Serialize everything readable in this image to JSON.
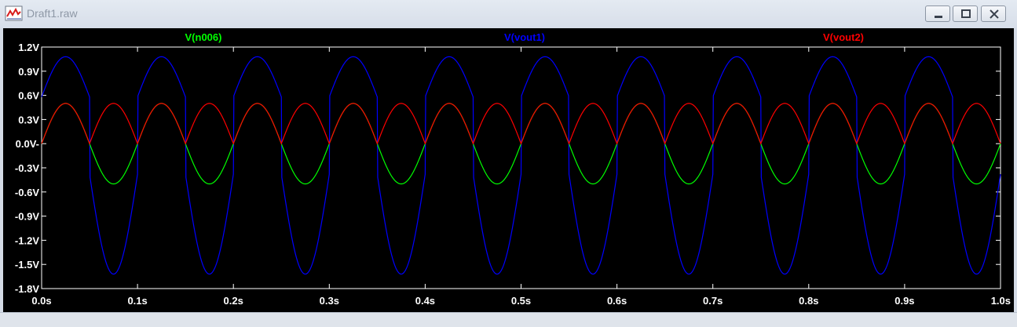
{
  "window": {
    "title": "Draft1.raw",
    "icon": "waveform-plot-icon",
    "controls": {
      "minimize": "minimize-icon",
      "maximize": "maximize-icon",
      "close": "close-icon"
    }
  },
  "colors": {
    "background": "#000000",
    "frame": "#ffffff",
    "axis_text": "#ffffff",
    "n006": "#00ff00",
    "vout1": "#0000ff",
    "vout2": "#ff0000"
  },
  "chart_data": {
    "type": "line",
    "title": "",
    "xlabel": "",
    "ylabel": "",
    "xlim": [
      0,
      1.0
    ],
    "ylim": [
      -1.8,
      1.2
    ],
    "grid": false,
    "legend_position": "top",
    "x_ticks": [
      0,
      0.1,
      0.2,
      0.3,
      0.4,
      0.5,
      0.6,
      0.7,
      0.8,
      0.9,
      1.0
    ],
    "x_tick_labels": [
      "0.0s",
      "0.1s",
      "0.2s",
      "0.3s",
      "0.4s",
      "0.5s",
      "0.6s",
      "0.7s",
      "0.8s",
      "0.9s",
      "1.0s"
    ],
    "y_ticks": [
      1.2,
      0.9,
      0.6,
      0.3,
      0.0,
      -0.3,
      -0.6,
      -0.9,
      -1.2,
      -1.5,
      -1.8
    ],
    "y_tick_labels": [
      "1.2V",
      "0.9V",
      "0.6V",
      "0.3V",
      "0.0V-",
      "-0.3V",
      "-0.6V",
      "-0.9V",
      "-1.2V",
      "-1.5V",
      "-1.8V"
    ],
    "series": [
      {
        "name": "V(n006)",
        "color": "#00ff00",
        "waveform": "sine",
        "frequency_hz": 10,
        "amplitude_v": 0.5,
        "offset_v": 0.0
      },
      {
        "name": "V(vout1)",
        "color": "#0000ff",
        "waveform": "piecewise-sine",
        "frequency_hz": 10,
        "positive_peak_v": 1.08,
        "negative_peak_v": -1.62,
        "positive_jump_v": 0.58,
        "negative_jump_v": -0.38
      },
      {
        "name": "V(vout2)",
        "color": "#ff0000",
        "waveform": "rectified-sine",
        "frequency_hz": 10,
        "amplitude_v": 0.5,
        "offset_v": 0.0
      }
    ]
  }
}
